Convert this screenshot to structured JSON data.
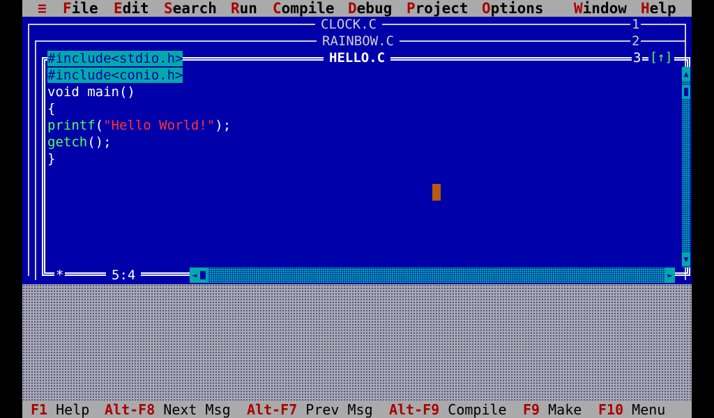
{
  "menu": {
    "system": "≡",
    "items": [
      {
        "hotkey": "F",
        "rest": "ile"
      },
      {
        "hotkey": "E",
        "rest": "dit"
      },
      {
        "hotkey": "S",
        "rest": "earch"
      },
      {
        "hotkey": "R",
        "rest": "un"
      },
      {
        "hotkey": "C",
        "rest": "ompile"
      },
      {
        "hotkey": "D",
        "rest": "ebug"
      },
      {
        "hotkey": "P",
        "rest": "roject"
      },
      {
        "hotkey": "O",
        "rest": "ptions"
      },
      {
        "hotkey": "W",
        "rest": "indow"
      },
      {
        "hotkey": "H",
        "rest": "elp"
      }
    ]
  },
  "windows": [
    {
      "title": "CLOCK.C",
      "number": "1"
    },
    {
      "title": "RAINBOW.C",
      "number": "2"
    },
    {
      "title": "HELLO.C",
      "number": "3"
    }
  ],
  "editor": {
    "close_button": "[■]",
    "zoom_button": "[↑]",
    "modified_marker": "*",
    "cursor_position": "5:4",
    "lines": [
      "#include<stdio.h>",
      "#include<conio.h>",
      "void main()",
      "{",
      "printf(\"Hello World!\");",
      "getch();",
      "}"
    ]
  },
  "scroll": {
    "up": "▲",
    "down": "▼",
    "left": "◄",
    "right": "►"
  },
  "status": [
    {
      "key": "F1",
      "label": "Help"
    },
    {
      "key": "Alt-F8",
      "label": "Next Msg"
    },
    {
      "key": "Alt-F7",
      "label": "Prev Msg"
    },
    {
      "key": "Alt-F9",
      "label": "Compile"
    },
    {
      "key": "F9",
      "label": "Make"
    },
    {
      "key": "F10",
      "label": "Menu"
    }
  ],
  "colors": {
    "editor_bg": "#0000aa",
    "chrome_bg": "#aaaaaa",
    "hotkey": "#aa0000",
    "selection": "#00aaaa",
    "identifier": "#55ff55",
    "string": "#ff3333",
    "cursor": "#b85a10"
  }
}
